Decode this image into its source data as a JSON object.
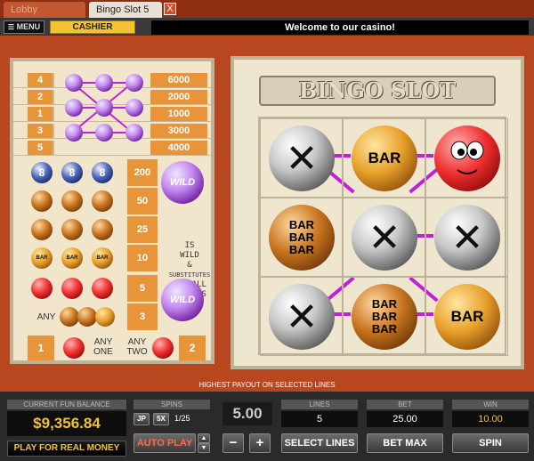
{
  "tabs": [
    {
      "label": "Lobby"
    },
    {
      "label": "Bingo Slot 5 ..."
    }
  ],
  "tab_close": "X",
  "menu": {
    "menu_label": "MENU",
    "cashier_label": "CASHIER",
    "welcome": "Welcome to our casino!"
  },
  "paytable": {
    "lines": [
      {
        "line": "4",
        "pay": "6000"
      },
      {
        "line": "2",
        "pay": "2000"
      },
      {
        "line": "1",
        "pay": "1000"
      },
      {
        "line": "3",
        "pay": "3000"
      },
      {
        "line": "5",
        "pay": "4000"
      }
    ],
    "wild_label": "WILD",
    "blue_ball_label": "8",
    "payouts": [
      "200",
      "50",
      "25",
      "10",
      "5",
      "3"
    ],
    "wild_text": [
      "IS",
      "WILD",
      "&",
      "SUBSTITUTES",
      "FOR ALL",
      "SYMBOLS"
    ],
    "any_label": "ANY",
    "bar_label": "BAR",
    "bottom_left": "1",
    "any_one": "ANY ONE",
    "any_two": "ANY TWO",
    "bottom_right": "2"
  },
  "reels": {
    "title": "BINGO SLOT",
    "symbols": [
      [
        "X",
        "BAR",
        "SMILEY"
      ],
      [
        "BARBARBAR",
        "X",
        "X"
      ],
      [
        "X",
        "BARBARBAR",
        "BAR"
      ]
    ],
    "bar_text": "BAR",
    "x_text": "✕"
  },
  "highest_payout": "HIGHEST PAYOUT ON SELECTED LINES",
  "bottom": {
    "balance_label": "CURRENT FUN BALANCE",
    "balance": "$9,356.84",
    "play_real": "PLAY FOR REAL MONEY",
    "spins_label": "SPINS",
    "jp_label": "JP",
    "fivex_label": "5X",
    "spins_count": "1/25",
    "autoplay_label": "AUTO PLAY",
    "coin_value": "5.00",
    "minus": "−",
    "plus": "+",
    "lines_label": "LINES",
    "lines_value": "5",
    "select_lines": "SELECT LINES",
    "bet_label": "BET",
    "bet_value": "25.00",
    "bet_max": "BET MAX",
    "win_label": "WIN",
    "win_value": "10.00",
    "spin_label": "SPIN"
  },
  "colors": {
    "accent_orange": "#e8953a",
    "balance_yellow": "#f2c233",
    "payline": "#c020d8"
  }
}
